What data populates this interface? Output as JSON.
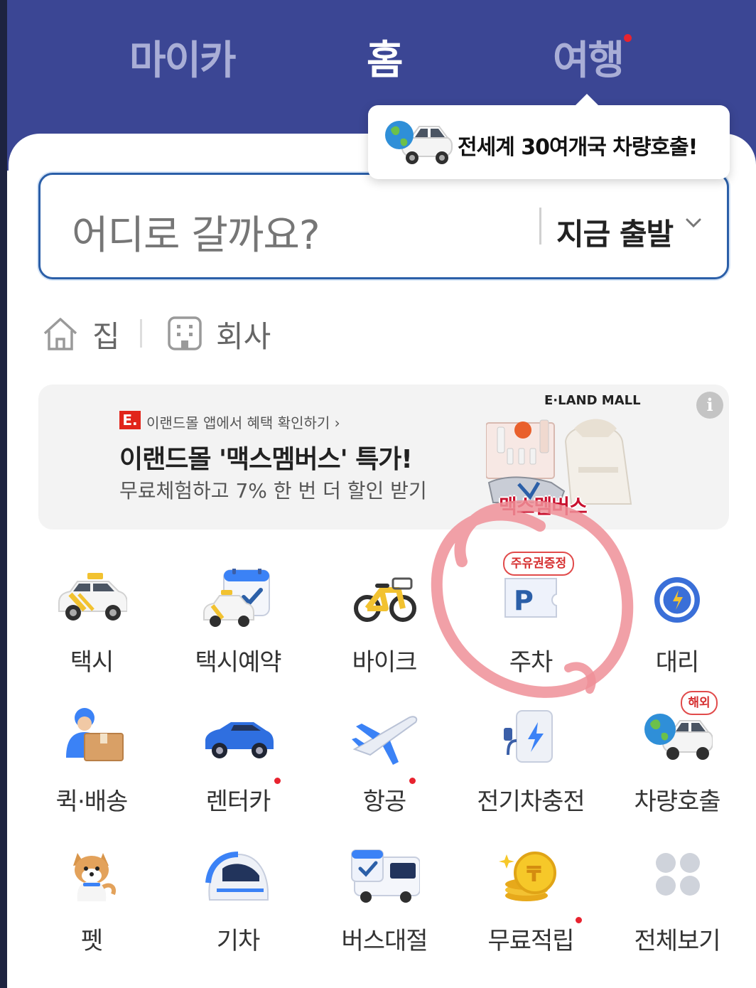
{
  "header": {
    "tabs": [
      {
        "label": "마이카",
        "active": false
      },
      {
        "label": "홈",
        "active": true
      },
      {
        "label": "여행",
        "active": false,
        "has_dot": true
      }
    ]
  },
  "tooltip": {
    "text": "전세계 30여개국 차량호출!",
    "icon": "globe-car-icon"
  },
  "search": {
    "placeholder": "어디로 갈까요?",
    "depart_label": "지금 출발"
  },
  "quick_places": [
    {
      "label": "집",
      "icon": "home-icon"
    },
    {
      "label": "회사",
      "icon": "building-icon"
    }
  ],
  "banner": {
    "source_text": "이랜드몰 앱에서 혜택 확인하기 ›",
    "logo_text": "E.",
    "title": "이랜드몰 '맥스멤버스' 특가!",
    "subtitle": "무료체험하고 7% 한 번 더 할인 받기",
    "brand": "E·LAND MALL",
    "tag": "맥스멤버스"
  },
  "services": [
    {
      "label": "택시",
      "icon": "taxi-icon"
    },
    {
      "label": "택시예약",
      "icon": "taxi-reservation-icon"
    },
    {
      "label": "바이크",
      "icon": "bike-icon"
    },
    {
      "label": "주차",
      "icon": "parking-icon",
      "badge": "주유권증정"
    },
    {
      "label": "대리",
      "icon": "designated-driver-icon"
    },
    {
      "label": "퀵·배송",
      "icon": "delivery-icon"
    },
    {
      "label": "렌터카",
      "icon": "rental-car-icon",
      "has_dot": true
    },
    {
      "label": "항공",
      "icon": "airplane-icon",
      "has_dot": true
    },
    {
      "label": "전기차충전",
      "icon": "ev-charger-icon"
    },
    {
      "label": "차량호출",
      "icon": "globe-car-icon",
      "badge": "해외"
    },
    {
      "label": "펫",
      "icon": "dog-icon"
    },
    {
      "label": "기차",
      "icon": "train-icon"
    },
    {
      "label": "버스대절",
      "icon": "bus-charter-icon"
    },
    {
      "label": "무료적립",
      "icon": "coin-icon",
      "has_dot": true
    },
    {
      "label": "전체보기",
      "icon": "grid-icon"
    }
  ],
  "colors": {
    "header_bg": "#3b4694",
    "accent": "#2b5fa8",
    "dot": "#e8232f",
    "annotation": "#ee8f98"
  }
}
